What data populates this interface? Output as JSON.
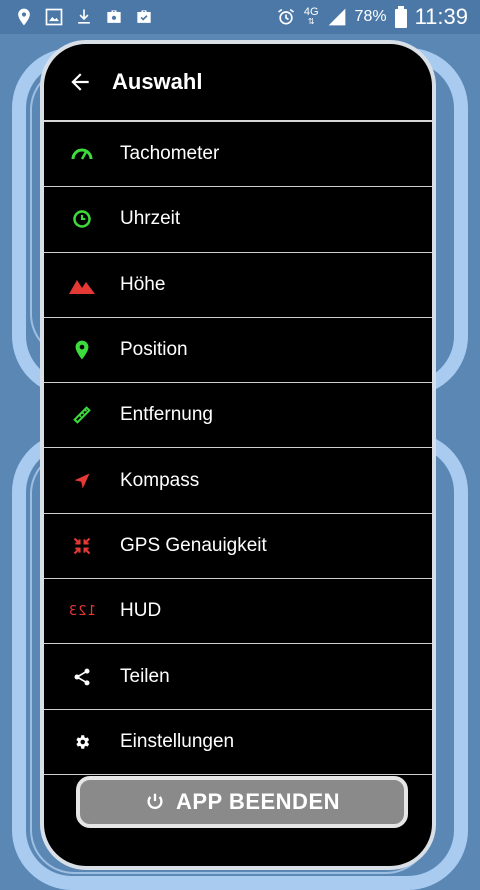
{
  "status_bar": {
    "network": "4G",
    "battery": "78%",
    "time": "11:39",
    "icons": [
      "location-icon",
      "image-icon",
      "download-icon",
      "briefcase-icon",
      "briefcase-check-icon",
      "alarm-icon",
      "signal-icon",
      "battery-icon"
    ]
  },
  "drawer": {
    "title": "Auswahl",
    "back_icon": "arrow-left-icon",
    "items": [
      {
        "label": "Tachometer",
        "icon": "speedometer-icon",
        "color": "#3ddc3d"
      },
      {
        "label": "Uhrzeit",
        "icon": "clock-icon",
        "color": "#3ddc3d"
      },
      {
        "label": "Höhe",
        "icon": "mountain-icon",
        "color": "#e53935"
      },
      {
        "label": "Position",
        "icon": "location-pin-icon",
        "color": "#3ddc3d"
      },
      {
        "label": "Entfernung",
        "icon": "ruler-icon",
        "color": "#3ddc3d"
      },
      {
        "label": "Kompass",
        "icon": "navigation-arrow-icon",
        "color": "#e53935"
      },
      {
        "label": "GPS Genauigkeit",
        "icon": "compress-icon",
        "color": "#e53935"
      },
      {
        "label": "HUD",
        "icon": "hud-123-icon",
        "glyph": "123",
        "color": "#e53935"
      },
      {
        "label": "Teilen",
        "icon": "share-icon",
        "color": "#ffffff"
      },
      {
        "label": "Einstellungen",
        "icon": "gear-icon",
        "color": "#ffffff"
      }
    ],
    "quit_button": {
      "label": "APP BEENDEN",
      "icon": "power-icon"
    }
  }
}
